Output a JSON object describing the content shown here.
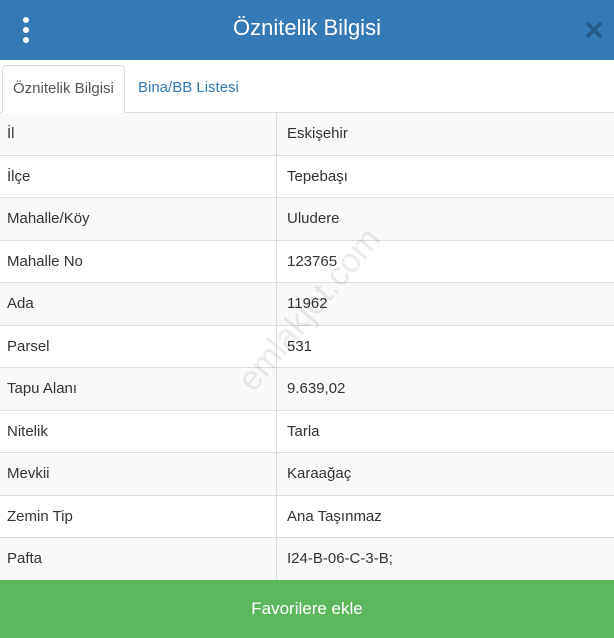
{
  "header": {
    "title": "Öznitelik Bilgisi",
    "menu_icon": "vertical-ellipsis-icon",
    "close_icon": "close-icon"
  },
  "tabs": [
    {
      "label": "Öznitelik Bilgisi",
      "active": true
    },
    {
      "label": "Bina/BB Listesi",
      "active": false
    }
  ],
  "attributes": [
    {
      "label": "İl",
      "value": "Eskişehir"
    },
    {
      "label": "İlçe",
      "value": "Tepebaşı"
    },
    {
      "label": "Mahalle/Köy",
      "value": "Uludere"
    },
    {
      "label": "Mahalle No",
      "value": "123765"
    },
    {
      "label": "Ada",
      "value": "11962"
    },
    {
      "label": "Parsel",
      "value": "531"
    },
    {
      "label": "Tapu Alanı",
      "value": "9.639,02"
    },
    {
      "label": "Nitelik",
      "value": "Tarla"
    },
    {
      "label": "Mevkii",
      "value": "Karaağaç"
    },
    {
      "label": "Zemin Tip",
      "value": "Ana Taşınmaz"
    },
    {
      "label": "Pafta",
      "value": "I24-B-06-C-3-B;"
    }
  ],
  "watermark": "emlakjet.com",
  "footer": {
    "button_label": "Favorilere ekle"
  },
  "colors": {
    "header": "#337ab7",
    "footer": "#5cb85c",
    "tab_link": "#337ab7"
  }
}
